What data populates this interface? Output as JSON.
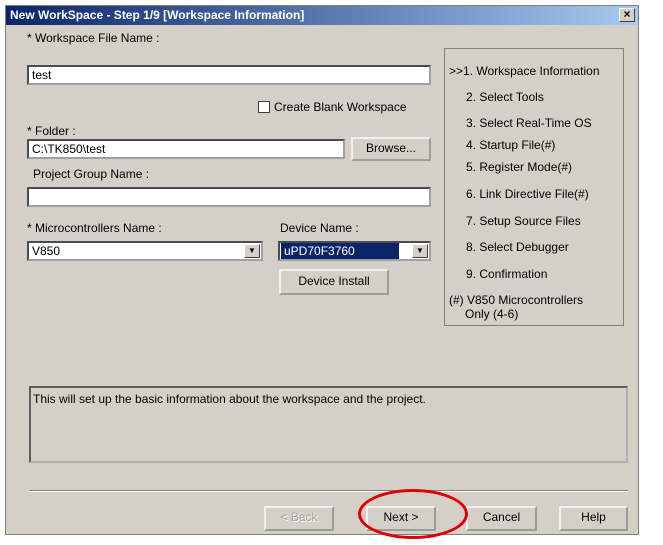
{
  "window": {
    "title": "New WorkSpace - Step 1/9 [Workspace Information]",
    "close_glyph": "×"
  },
  "form": {
    "workspace_file_name_label": "* Workspace File Name :",
    "workspace_file_name_value": "test",
    "create_blank_label": "Create Blank Workspace",
    "create_blank_checked": false,
    "folder_label": "* Folder :",
    "folder_value": "C:\\TK850\\test",
    "browse_label": "Browse...",
    "project_group_label": "Project Group Name :",
    "project_group_value": "",
    "micro_label": "* Microcontrollers Name :",
    "micro_value": "V850",
    "device_label": "Device Name :",
    "device_value": "uPD70F3760",
    "device_install_label": "Device Install"
  },
  "steps": [
    ">>1. Workspace Information",
    "2. Select Tools",
    "3. Select Real-Time OS",
    "4. Startup File(#)",
    "5. Register Mode(#)",
    "6. Link Directive File(#)",
    "7. Setup Source Files",
    "8. Select Debugger",
    "9. Confirmation"
  ],
  "steps_note": {
    "line1": "(#) V850 Microcontrollers",
    "line2": "Only (4-6)"
  },
  "description": "This will set up the basic information about the workspace and the project.",
  "buttons": {
    "back": "< Back",
    "next": "Next >",
    "cancel": "Cancel",
    "help": "Help"
  }
}
